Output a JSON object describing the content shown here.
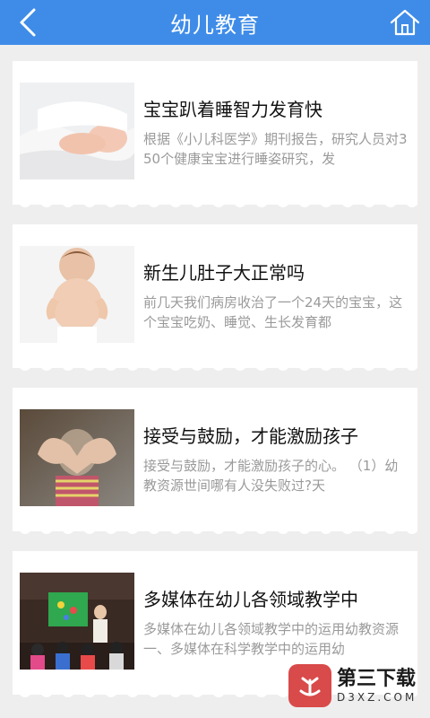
{
  "header": {
    "title": "幼儿教育",
    "back_icon": "chevron-left-icon",
    "home_icon": "home-icon",
    "color": "#3f8ce8"
  },
  "articles": [
    {
      "title": "宝宝趴着睡智力发育快",
      "description": "根据《小儿科医学》期刊报告，研究人员对350个健康宝宝进行睡姿研究，发",
      "image": "sleeping-baby-photo"
    },
    {
      "title": "新生儿肚子大正常吗",
      "description": "前几天我们病房收治了一个24天的宝宝，这个宝宝吃奶、睡觉、生长发育都",
      "image": "toddler-belly-photo"
    },
    {
      "title": "接受与鼓励，才能激励孩子",
      "description": "接受与鼓励，才能激励孩子的心。 （1）幼教资源世间哪有人没失败过?天",
      "image": "heart-hands-photo"
    },
    {
      "title": "多媒体在幼儿各领域教学中",
      "description": "多媒体在幼儿各领域教学中的运用幼教资源一、多媒体在科学教学中的运用幼",
      "image": "classroom-multimedia-photo"
    }
  ],
  "watermark": {
    "title": "第三下载",
    "subtitle": "D3XZ.COM",
    "color": "#d94a4a"
  }
}
